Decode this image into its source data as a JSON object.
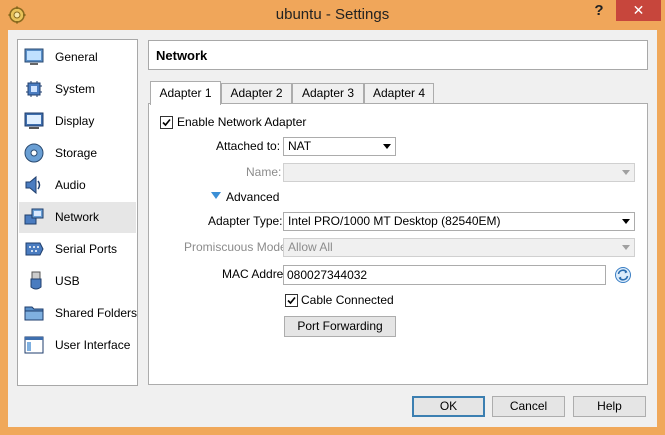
{
  "window": {
    "title": "ubuntu - Settings",
    "help_glyph": "?",
    "close_glyph": "✕"
  },
  "sidebar": {
    "items": [
      {
        "label": "General",
        "icon": "general-icon"
      },
      {
        "label": "System",
        "icon": "system-icon"
      },
      {
        "label": "Display",
        "icon": "display-icon"
      },
      {
        "label": "Storage",
        "icon": "storage-icon"
      },
      {
        "label": "Audio",
        "icon": "audio-icon"
      },
      {
        "label": "Network",
        "icon": "network-icon",
        "selected": true
      },
      {
        "label": "Serial Ports",
        "icon": "serial-ports-icon"
      },
      {
        "label": "USB",
        "icon": "usb-icon"
      },
      {
        "label": "Shared Folders",
        "icon": "shared-folders-icon"
      },
      {
        "label": "User Interface",
        "icon": "user-interface-icon"
      }
    ]
  },
  "page": {
    "title": "Network"
  },
  "tabs": [
    "Adapter 1",
    "Adapter 2",
    "Adapter 3",
    "Adapter 4"
  ],
  "adapter": {
    "enable_label": "Enable Network Adapter",
    "enabled": true,
    "attached_to_label": "Attached to:",
    "attached_to_value": "NAT",
    "name_label": "Name:",
    "name_value": "",
    "advanced_label": "Advanced",
    "adapter_type_label": "Adapter Type:",
    "adapter_type_value": "Intel PRO/1000 MT Desktop (82540EM)",
    "promiscuous_label": "Promiscuous Mode:",
    "promiscuous_value": "Allow All",
    "mac_label": "MAC Address:",
    "mac_value": "080027344032",
    "cable_label": "Cable Connected",
    "cable_connected": true,
    "port_forwarding_label": "Port Forwarding"
  },
  "buttons": {
    "ok": "OK",
    "cancel": "Cancel",
    "help": "Help"
  },
  "colors": {
    "titlebar": "#f0a65a",
    "close_button": "#c7463c",
    "accent": "#3c7fb1"
  }
}
